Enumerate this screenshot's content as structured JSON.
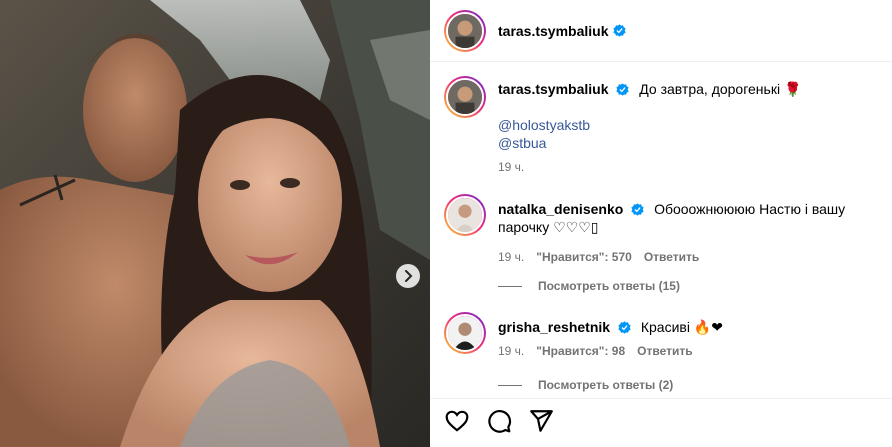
{
  "post": {
    "author": "taras.tsymbaliuk",
    "caption": {
      "username": "taras.tsymbaliuk",
      "text": "До завтра, дорогенькі 🌹",
      "mentions": [
        "@holostyakstb",
        "@stbua"
      ],
      "time": "19 ч."
    }
  },
  "comments": [
    {
      "username": "natalka_denisenko",
      "text": "Обооожнюююю Настю і вашу парочку ♡♡♡▯",
      "time": "19 ч.",
      "likes_label": "\"Нравится\": 570",
      "reply_label": "Ответить",
      "view_replies": "Посмотреть ответы (15)"
    },
    {
      "username": "grisha_reshetnik",
      "text": "Красиві 🔥❤",
      "time": "19 ч.",
      "likes_label": "\"Нравится\": 98",
      "reply_label": "Ответить",
      "view_replies": "Посмотреть ответы (2)"
    }
  ],
  "icons": {
    "verified": "verified-badge-icon",
    "like": "heart-icon",
    "comment": "comment-bubble-icon",
    "share": "paper-plane-icon",
    "next": "chevron-right-icon"
  },
  "colors": {
    "verified": "#0095f6",
    "mention": "#385898",
    "meta": "#737373",
    "story_ring_start": "#f9ce34",
    "story_ring_end": "#6228d7"
  }
}
